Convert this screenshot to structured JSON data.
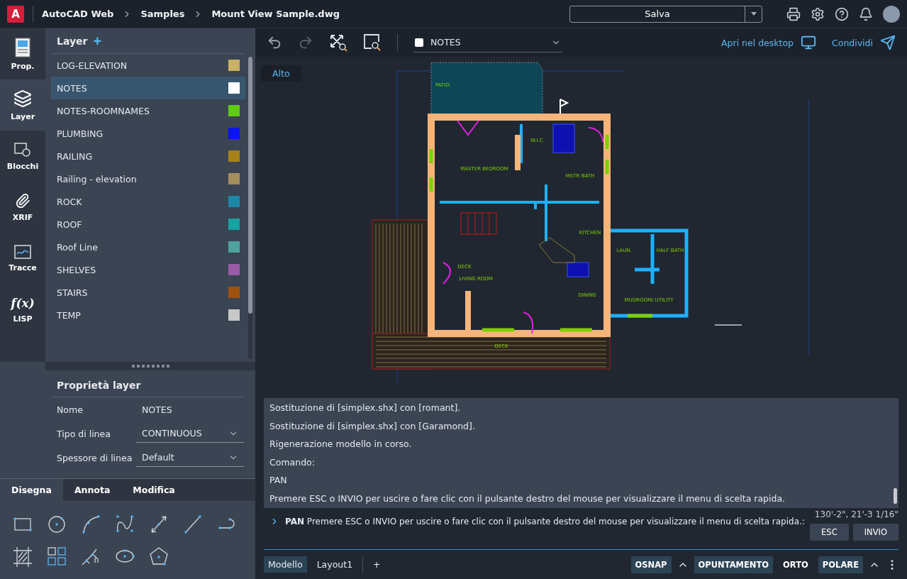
{
  "app": {
    "breadcrumb": [
      "AutoCAD Web",
      "Samples",
      "Mount View Sample.dwg"
    ],
    "logo": "A"
  },
  "save": {
    "label": "Salva"
  },
  "rail": [
    {
      "label": "Prop.",
      "selected": false
    },
    {
      "label": "Layer",
      "selected": true
    },
    {
      "label": "Blocchi",
      "selected": false
    },
    {
      "label": "XRIF",
      "selected": false
    },
    {
      "label": "Tracce",
      "selected": false
    },
    {
      "label": "LISP",
      "glyph": "f(x)",
      "selected": false
    }
  ],
  "layer_panel": {
    "title": "Layer",
    "add": "+",
    "layers": [
      {
        "name": "LOG-ELEVATION",
        "color": "#c9b263",
        "selected": false
      },
      {
        "name": "NOTES",
        "color": "#ffffff",
        "selected": true
      },
      {
        "name": "NOTES-ROOMNAMES",
        "color": "#5fcc12",
        "selected": false
      },
      {
        "name": "PLUMBING",
        "color": "#0a14f0",
        "selected": false
      },
      {
        "name": "RAILING",
        "color": "#a7821a",
        "selected": false
      },
      {
        "name": "Railing - elevation",
        "color": "#a38f5c",
        "selected": false
      },
      {
        "name": "ROCK",
        "color": "#1d87a6",
        "selected": false
      },
      {
        "name": "ROOF",
        "color": "#16a3a3",
        "selected": false
      },
      {
        "name": "Roof Line",
        "color": "#4fa39e",
        "selected": false
      },
      {
        "name": "SHELVES",
        "color": "#9a5aa6",
        "selected": false
      },
      {
        "name": "STAIRS",
        "color": "#a0520f",
        "selected": false
      },
      {
        "name": "TEMP",
        "color": "#c8c8c8",
        "selected": false
      }
    ]
  },
  "layer_properties": {
    "title": "Proprietà layer",
    "rows": [
      {
        "label": "Nome",
        "value": "NOTES",
        "kind": "text"
      },
      {
        "label": "Tipo di linea",
        "value": "CONTINUOUS",
        "kind": "select"
      },
      {
        "label": "Spessore di linea",
        "value": "Default",
        "kind": "select"
      }
    ]
  },
  "tool_tabs": [
    {
      "label": "Disegna",
      "selected": true
    },
    {
      "label": "Annota",
      "selected": false
    },
    {
      "label": "Modifica",
      "selected": false
    }
  ],
  "toolbar": {
    "layer": "NOTES",
    "open_desktop": "Apri nel desktop",
    "share": "Condividi"
  },
  "view_label": "Alto",
  "floor_plan": {
    "labels": [
      "PATIO",
      "MASTER BEDROOM",
      "W.I.C.",
      "MSTR BATH",
      "KITCHEN",
      "LIVING ROOM",
      "DINING",
      "DECK",
      "DECK",
      "LAUN.",
      "HALF BATH",
      "MUDROOM/ UTILITY"
    ]
  },
  "history": [
    "Sostituzione di [simplex.shx] con [romant].",
    "Sostituzione di [simplex.shx] con [Garamond].",
    "Rigenerazione modello in corso.",
    "Comando:",
    "PAN",
    "Premere ESC o INVIO per uscire o fare clic con il pulsante destro del mouse per visualizzare il menu di scelta rapida."
  ],
  "command": {
    "prompt": "PAN",
    "text": "Premere ESC o INVIO per uscire o fare clic con il pulsante destro del mouse per visualizzare il menu di scelta rapida.:",
    "buttons": [
      "ESC",
      "INVIO"
    ]
  },
  "coordinates": "130'-2\", 21'-3 1/16\"",
  "layouts": [
    {
      "label": "Modello",
      "selected": true
    },
    {
      "label": "Layout1",
      "selected": false
    }
  ],
  "add_layout": "+",
  "status_toggles": [
    {
      "label": "OSNAP",
      "on": true,
      "menu": true
    },
    {
      "label": "OPUNTAMENTO",
      "on": true,
      "menu": false
    },
    {
      "label": "ORTO",
      "on": false,
      "menu": false
    },
    {
      "label": "POLARE",
      "on": true,
      "menu": true
    }
  ]
}
